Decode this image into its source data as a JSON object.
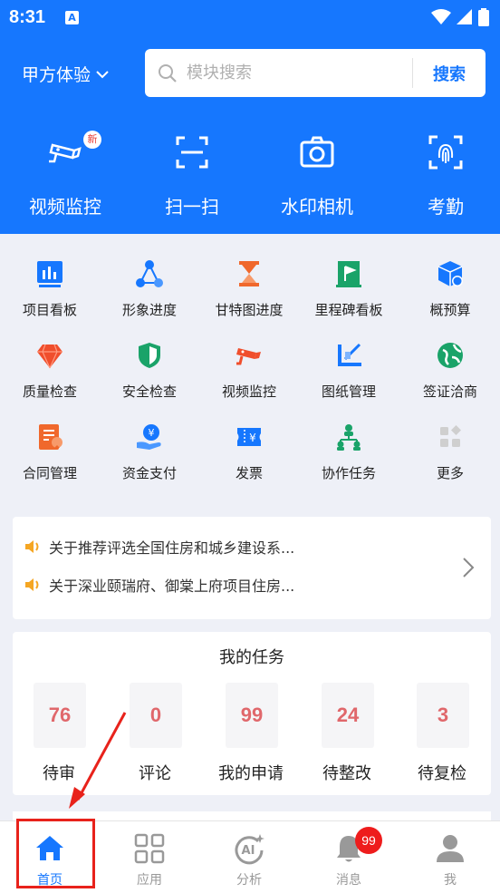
{
  "status_bar": {
    "time": "8:31",
    "indicator": "A"
  },
  "header": {
    "project_label": "甲方体验",
    "search": {
      "placeholder": "模块搜索",
      "button_label": "搜索"
    }
  },
  "quick_actions": [
    {
      "label": "视频监控",
      "icon": "cctv-camera-icon",
      "badge": "新"
    },
    {
      "label": "扫一扫",
      "icon": "scan-icon"
    },
    {
      "label": "水印相机",
      "icon": "camera-icon"
    },
    {
      "label": "考勤",
      "icon": "fingerprint-icon"
    }
  ],
  "modules": [
    {
      "label": "项目看板",
      "icon": "dashboard-icon",
      "color": "#1677fe"
    },
    {
      "label": "形象进度",
      "icon": "network-icon",
      "color": "#1677fe"
    },
    {
      "label": "甘特图进度",
      "icon": "hourglass-icon",
      "color": "#f0682c"
    },
    {
      "label": "里程碑看板",
      "icon": "flag-icon",
      "color": "#1aa369"
    },
    {
      "label": "概预算",
      "icon": "cube-icon",
      "color": "#1677fe"
    },
    {
      "label": "质量检查",
      "icon": "diamond-icon",
      "color": "#f04e2c"
    },
    {
      "label": "安全检查",
      "icon": "shield-icon",
      "color": "#1aa369"
    },
    {
      "label": "视频监控",
      "icon": "cctv-camera-icon",
      "color": "#f04e2c"
    },
    {
      "label": "图纸管理",
      "icon": "drawing-icon",
      "color": "#1677fe"
    },
    {
      "label": "签证洽商",
      "icon": "globe-icon",
      "color": "#1aa369"
    },
    {
      "label": "合同管理",
      "icon": "contract-icon",
      "color": "#f0682c"
    },
    {
      "label": "资金支付",
      "icon": "payment-icon",
      "color": "#1677fe"
    },
    {
      "label": "发票",
      "icon": "invoice-icon",
      "color": "#1677fe"
    },
    {
      "label": "协作任务",
      "icon": "collaboration-icon",
      "color": "#1aa369"
    },
    {
      "label": "更多",
      "icon": "more-apps-icon",
      "color": "#c8c8c8"
    }
  ],
  "notices": [
    {
      "text": "关于推荐评选全国住房和城乡建设系..."
    },
    {
      "text": "关于深业颐瑞府、御棠上府项目住房..."
    }
  ],
  "tasks": {
    "title": "我的任务",
    "items": [
      {
        "count": "76",
        "label": "待审"
      },
      {
        "count": "0",
        "label": "评论"
      },
      {
        "count": "99",
        "label": "我的申请"
      },
      {
        "count": "24",
        "label": "待整改"
      },
      {
        "count": "3",
        "label": "待复检"
      }
    ]
  },
  "bottom_nav": {
    "items": [
      {
        "label": "首页",
        "icon": "home-icon",
        "active": true
      },
      {
        "label": "应用",
        "icon": "apps-grid-icon"
      },
      {
        "label": "分析",
        "icon": "ai-analysis-icon"
      },
      {
        "label": "消息",
        "icon": "bell-icon",
        "badge": "99"
      },
      {
        "label": "我",
        "icon": "profile-icon"
      }
    ]
  },
  "colors": {
    "primary": "#1677fe",
    "task_number": "#e0676b",
    "badge_red": "#ee1c1c",
    "annotation_red": "#e8221b"
  }
}
